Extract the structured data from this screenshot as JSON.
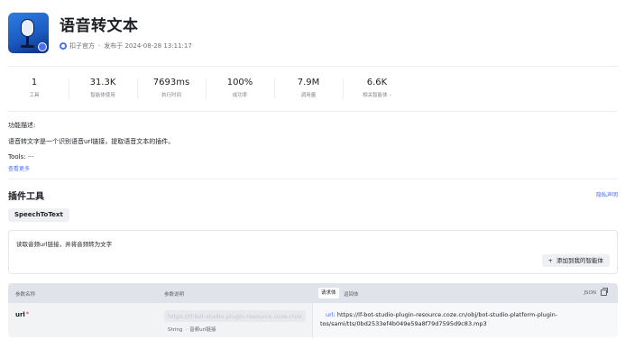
{
  "plugin": {
    "name": "语音转文本",
    "publisher": "扣子官方",
    "published_label": "发布于 2024-08-28 13:11:17"
  },
  "stats": [
    {
      "value": "1",
      "label": "工具"
    },
    {
      "value": "31.3K",
      "label": "智能体使用"
    },
    {
      "value": "7693ms",
      "label": "执行时间"
    },
    {
      "value": "100%",
      "label": "成功率"
    },
    {
      "value": "7.9M",
      "label": "调用量"
    },
    {
      "value": "6.6K",
      "label": "相关智能体"
    }
  ],
  "description": {
    "heading": "功能描述:",
    "text": "语音转文字是一个识别语音url链接，提取语音文本的插件。",
    "tools": "Tools: ···",
    "more_link": "查看更多"
  },
  "tools_section": {
    "title": "插件工具",
    "privacy_link": "隐私声明",
    "tool_tab": "SpeechToText",
    "tool_description": "读取音频url链接，并将音频转为文字",
    "add_button": "添加到我的智能体"
  },
  "params": {
    "col_name": "参数名称",
    "col_desc": "参数说明",
    "tab_request": "请求体",
    "tab_return": "返回体",
    "json_label": "JSON",
    "rows": [
      {
        "name": "url",
        "required_mark": "*",
        "placeholder": "https://lf-bot-studio-plugin-resource.coze.cn/obj",
        "type": "String",
        "type_desc": "音频url链接",
        "json_key": "url",
        "json_value": ": https://lf-bot-studio-plugin-resource.coze.cn/obj/bot-studio-platform-plugin-tos/sami/tts/0bd2533ef4b049e59a8f79d7595d9c83.mp3"
      }
    ]
  },
  "colors": {
    "accent": "#4c6ef5",
    "required": "#f54a45"
  }
}
